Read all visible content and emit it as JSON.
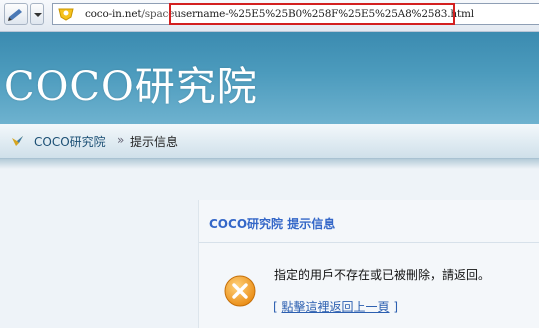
{
  "browser": {
    "url_host": "coco-in.net",
    "url_path": "/space",
    "url_query": "username-%25E5%25B0%258F%25E5%25A8%2583.html"
  },
  "site": {
    "logo_text": "COCO研究院"
  },
  "breadcrumb": {
    "home": "COCO研究院",
    "separator": "»",
    "current": "提示信息"
  },
  "message": {
    "title": "COCO研究院 提示信息",
    "text": "指定的用戶不存在或已被刪除，請返回。",
    "link_open": "[ ",
    "link_label": "點擊這裡返回上一頁",
    "link_close": " ]"
  },
  "colors": {
    "banner": "#4c9bbd",
    "title": "#3467c8",
    "link": "#2c5fb0",
    "highlight_box": "#d32020",
    "error_icon": "#f3a12a"
  }
}
